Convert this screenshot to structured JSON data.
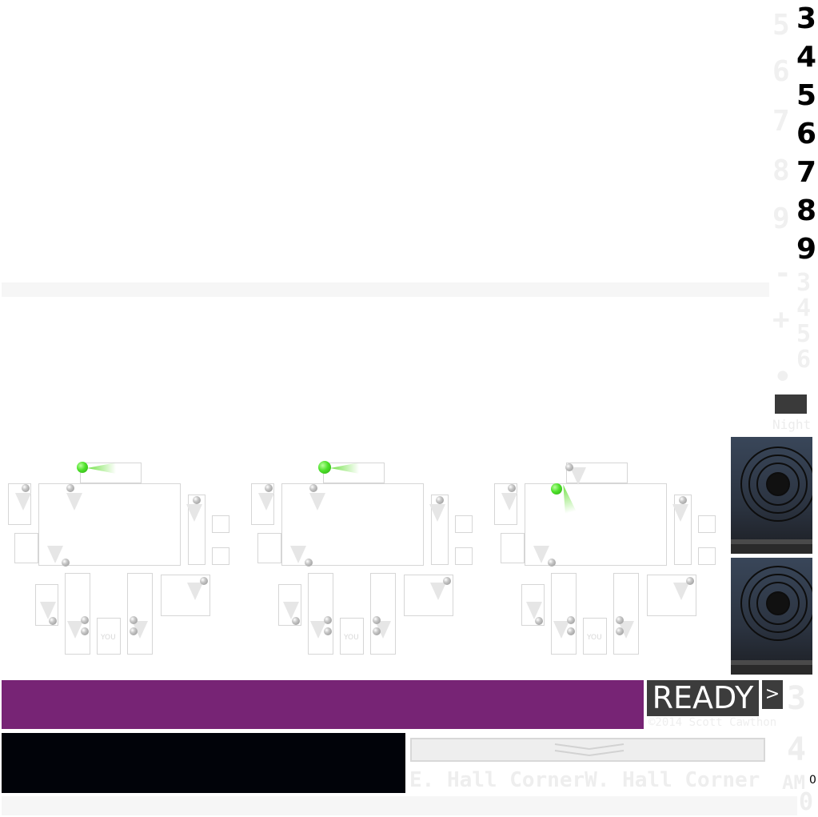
{
  "hour_numbers": [
    "3",
    "4",
    "5",
    "6",
    "7",
    "8",
    "9"
  ],
  "ghost_numbers": [
    "5",
    "6",
    "7",
    "8",
    "9"
  ],
  "ghost_symbols": [
    "-",
    "+",
    "•"
  ],
  "ghost_digits": [
    "3",
    "4",
    "5",
    "6"
  ],
  "night_label": "Night",
  "ready_label": "READY",
  "arrow_label": ">",
  "copyright": "©2014 Scott Cawthon",
  "hall_text": "E. Hall CornerW. Hall Corner",
  "am_text": "AM",
  "big_three": "3",
  "big_four": "4",
  "zero_text": "0",
  "small_zero": "0",
  "you_label": "YOU",
  "colors": {
    "ready_bar": "#772475",
    "ready_button": "#3c3c3c",
    "black_panel": "#010309",
    "camera_active": "#4de12a"
  },
  "maps": [
    {
      "active_camera": "top-stage"
    },
    {
      "active_camera": "top-stage"
    },
    {
      "active_camera": "dining-left"
    }
  ]
}
